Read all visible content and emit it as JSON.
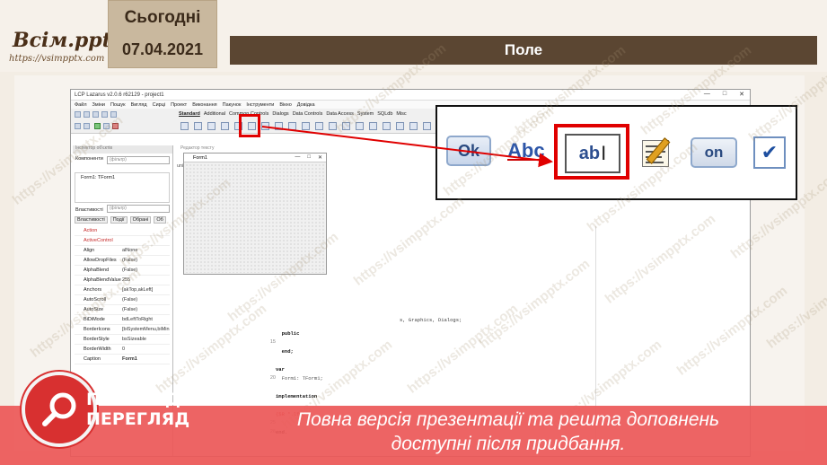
{
  "header": {
    "logo_main": "Всім.pptx",
    "logo_sub": "https://vsimpptx.com",
    "day": "Сьогодні",
    "date": "07.04.2021",
    "title": "Поле"
  },
  "ide": {
    "window_title": "LCP Lazarus v2.0.6 r62129 - project1",
    "window_controls": [
      "—",
      "□",
      "✕"
    ],
    "menu": [
      "Файл",
      "Зміни",
      "Пошук",
      "Вигляд",
      "Сирці",
      "Проект",
      "Виконання",
      "Пакунок",
      "Інструменти",
      "Вікно",
      "Довідка"
    ],
    "palette_tabs": [
      "Standard",
      "Additional",
      "Common Controls",
      "Dialogs",
      "Data Controls",
      "Data Access",
      "System",
      "SQLdb",
      "Misc"
    ],
    "object_inspector": {
      "header": "Інспектор об'єктів",
      "components_label": "Компоненти",
      "filter_placeholder": "(фільтр)",
      "tree_item": "Form1: TForm1",
      "properties_label": "Властивості",
      "tabs": [
        "Властивості",
        "Події",
        "Обрані",
        "Об"
      ],
      "properties": [
        {
          "name": "Action",
          "value": "",
          "red": true
        },
        {
          "name": "ActiveControl",
          "value": "",
          "red": true
        },
        {
          "name": "Align",
          "value": "alNone"
        },
        {
          "name": "AllowDropFiles",
          "value": "(False)"
        },
        {
          "name": "AlphaBlend",
          "value": "(False)"
        },
        {
          "name": "AlphaBlendValue",
          "value": "255"
        },
        {
          "name": "Anchors",
          "value": "[akTop,akLeft]"
        },
        {
          "name": "AutoScroll",
          "value": "(False)"
        },
        {
          "name": "AutoSize",
          "value": "(False)"
        },
        {
          "name": "BiDiMode",
          "value": "bdLeftToRight"
        },
        {
          "name": "BorderIcons",
          "value": "[biSystemMenu,biMin"
        },
        {
          "name": "BorderStyle",
          "value": "bsSizeable"
        },
        {
          "name": "BorderWidth",
          "value": "0"
        },
        {
          "name": "Caption",
          "value": "Form1",
          "bold": true
        }
      ]
    },
    "editor": {
      "header": "Редактор тексту",
      "unit_label": "uni",
      "form_title": "Form1",
      "uses_fragment": "s, Graphics, Dialogs;",
      "gutter": [
        "15",
        "",
        "",
        "",
        "20",
        "",
        "",
        "",
        "",
        "25",
        "26"
      ],
      "code": [
        {
          "t": "  public",
          "s": "b"
        },
        {
          "t": "",
          "s": ""
        },
        {
          "t": "  end;",
          "s": "b"
        },
        {
          "t": "",
          "s": ""
        },
        {
          "t": "var",
          "s": "b"
        },
        {
          "t": "  Form1: TForm1;",
          "s": "g"
        },
        {
          "t": "",
          "s": ""
        },
        {
          "t": "implementation",
          "s": "b"
        },
        {
          "t": "",
          "s": ""
        },
        {
          "t": "{$R *.lfm}",
          "s": "r"
        },
        {
          "t": "",
          "s": ""
        },
        {
          "t": "end.",
          "s": "b"
        }
      ]
    }
  },
  "zoom": {
    "ok_label": "Ok",
    "abc_label": "Abc",
    "edit_label": "ab",
    "on_label": "on",
    "check_label": "✔"
  },
  "overlay": {
    "preview_line1": "ПОПЕРЕДНІЙ",
    "preview_line2": "ПЕРЕГЛЯД",
    "message_line1": "Повна версія презентації та решта доповнень",
    "message_line2": "доступні після придбання.",
    "watermark": "https://vsimpptx.com"
  },
  "colors": {
    "header_bar": "#5b4632",
    "date_card": "#c9b89e",
    "highlight": "#e00000",
    "band": "#ec5858"
  }
}
